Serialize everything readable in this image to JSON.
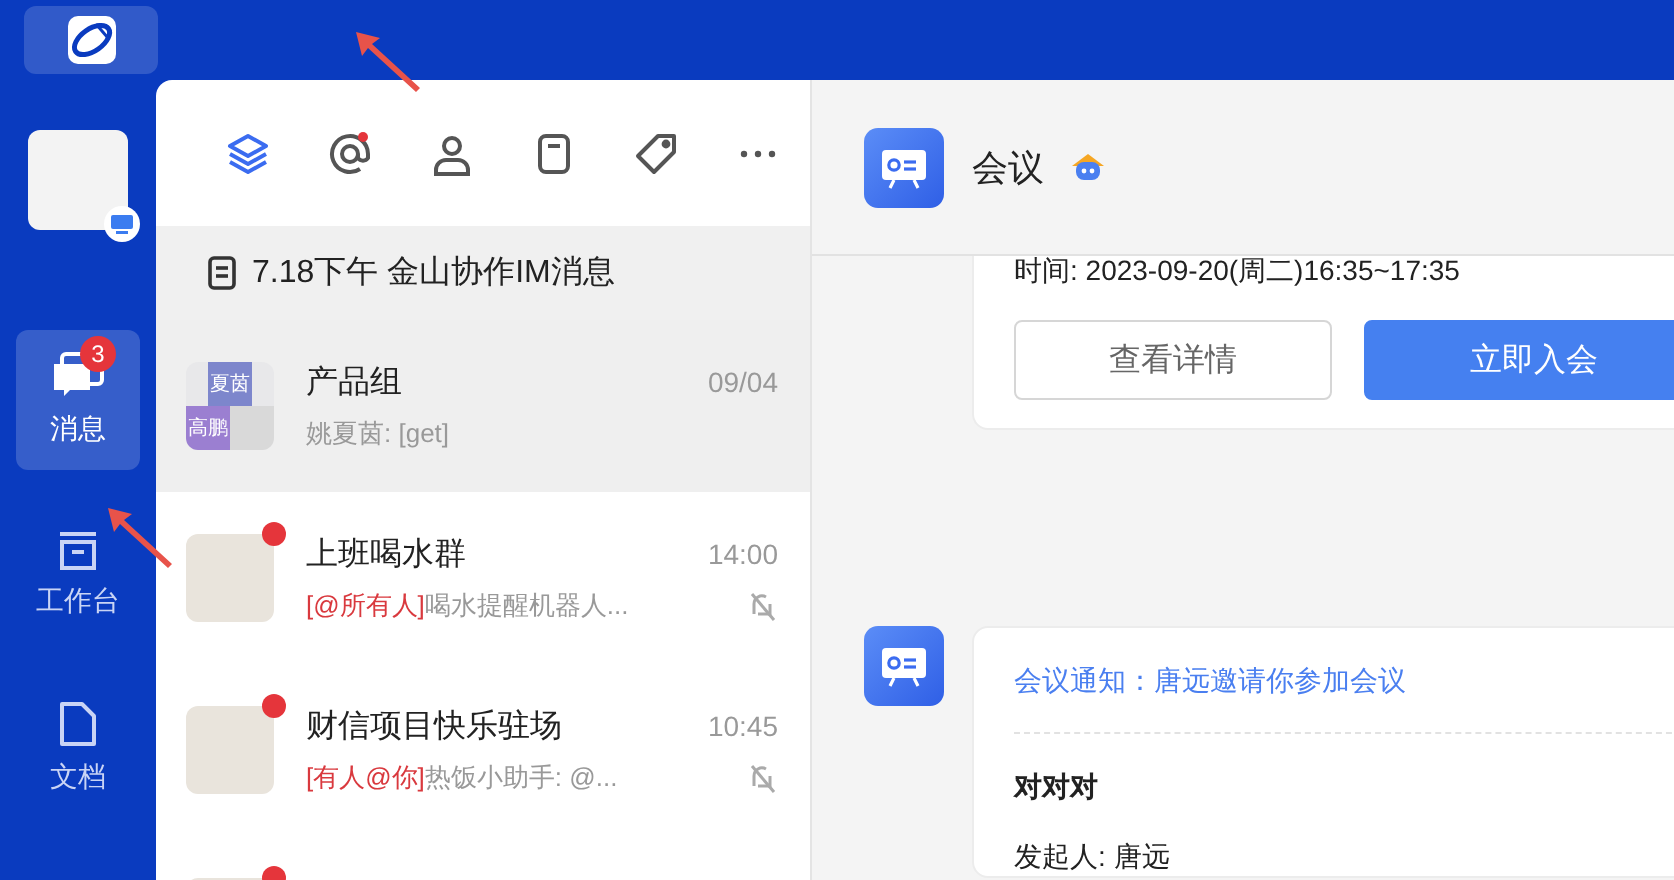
{
  "sidebar": {
    "avatar": {
      "online_device": true
    },
    "nav": [
      {
        "kind": "chat",
        "label": "消息",
        "selected": true,
        "badge": "3"
      },
      {
        "kind": "apps",
        "label": "工作台",
        "selected": false
      },
      {
        "kind": "doc",
        "label": "文档",
        "selected": false
      }
    ]
  },
  "chat_list": {
    "tabs": [
      {
        "kind": "layers",
        "selected": true,
        "unread": false
      },
      {
        "kind": "at",
        "selected": false,
        "unread": true
      },
      {
        "kind": "contact",
        "selected": false,
        "unread": false
      },
      {
        "kind": "doc",
        "selected": false,
        "unread": false
      },
      {
        "kind": "tag",
        "selected": false,
        "unread": false
      },
      {
        "kind": "more",
        "selected": false,
        "unread": false
      }
    ],
    "pinned": "7.18下午 金山协作IM消息",
    "chats": [
      {
        "kind": "group",
        "tiles": [
          "夏茵",
          "高鹏"
        ],
        "name": "产品组",
        "time": "09/04",
        "preview": "姚夏茵: [get]",
        "selected": true,
        "unread": false,
        "muted": false
      },
      {
        "kind": "photo",
        "name": "上班喝水群",
        "time": "14:00",
        "mention": "[@所有人]",
        "preview": "喝水提醒机器人...",
        "selected": false,
        "unread": true,
        "muted": true
      },
      {
        "kind": "photo",
        "name": "财信项目快乐驻场",
        "time": "10:45",
        "mention": "[有人@你]",
        "preview": "热饭小助手: @...",
        "selected": false,
        "unread": true,
        "muted": true
      },
      {
        "kind": "photo",
        "selected": false,
        "unread": true
      }
    ]
  },
  "conversation": {
    "title": "会议",
    "bot": true,
    "messages": [
      {
        "kind": "meeting_actions",
        "time_line": "时间: 2023-09-20(周二)16:35~17:35",
        "buttons": [
          {
            "kind": "secondary",
            "label": "查看详情"
          },
          {
            "kind": "primary",
            "label": "立即入会"
          }
        ]
      },
      {
        "kind": "meeting_notice",
        "link": "会议通知：唐远邀请你参加会议",
        "title": "对对对",
        "lines": [
          "发起人: 唐远"
        ]
      }
    ]
  }
}
